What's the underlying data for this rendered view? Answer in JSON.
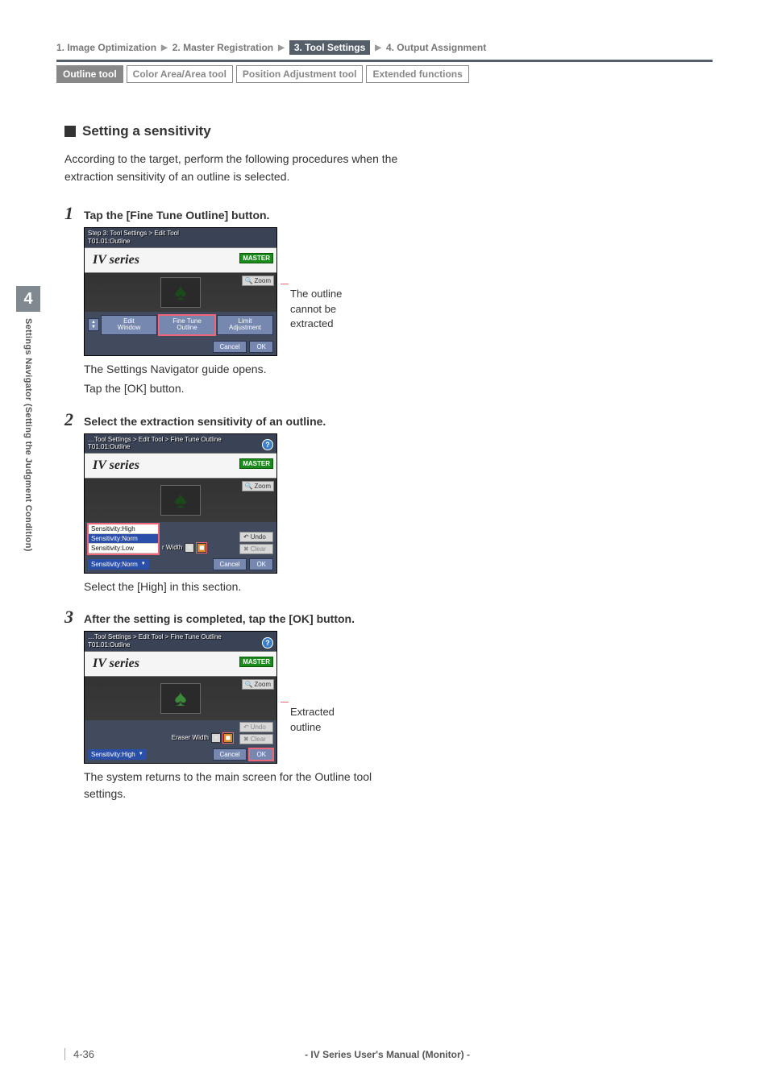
{
  "breadcrumb": {
    "items": [
      "1. Image Optimization",
      "2. Master Registration",
      "3. Tool Settings",
      "4. Output Assignment"
    ],
    "active_index": 2
  },
  "tabs": {
    "items": [
      "Outline tool",
      "Color Area/Area tool",
      "Position Adjustment tool",
      "Extended functions"
    ],
    "active_index": 0
  },
  "side_tab": {
    "chapter": "4",
    "title": "Settings Navigator (Setting the Judgment Condition)"
  },
  "section": {
    "title": "Setting a sensitivity"
  },
  "intro": "According to the target, perform the following procedures when the extraction sensitivity of an outline is selected.",
  "steps": {
    "s1": {
      "num": "1",
      "title": "Tap the [Fine Tune Outline] button.",
      "after1": "The Settings Navigator guide opens.",
      "after2": "Tap the [OK] button.",
      "callout": "The outline cannot be extracted"
    },
    "s2": {
      "num": "2",
      "title": "Select the extraction sensitivity of an outline.",
      "after": "Select the [High] in this section."
    },
    "s3": {
      "num": "3",
      "title": "After the setting is completed, tap the [OK] button.",
      "after": "The system returns to the main screen for the Outline tool settings.",
      "callout": "Extracted outline"
    }
  },
  "shot1": {
    "hdr1": "Step 3: Tool Settings > Edit Tool",
    "hdr2": "T01.01:Outline",
    "logo": "IV series",
    "master": "MASTER",
    "zoom": "Zoom",
    "btn_edit": "Edit\nWindow",
    "btn_fine": "Fine Tune\nOutline",
    "btn_limit": "Limit\nAdjustment",
    "cancel": "Cancel",
    "ok": "OK"
  },
  "shot2": {
    "hdr1": "…Tool Settings > Edit Tool > Fine Tune Outline",
    "hdr2": "T01.01:Outline",
    "logo": "IV series",
    "master": "MASTER",
    "zoom": "Zoom",
    "sens_high": "Sensitivity:High",
    "sens_norm": "Sensitivity:Norm",
    "sens_low": "Sensitivity:Low",
    "sens_cur": "Sensitivity:Norm",
    "eraser": "r Width",
    "undo": "Undo",
    "clear": "Clear",
    "cancel": "Cancel",
    "ok": "OK"
  },
  "shot3": {
    "hdr1": "…Tool Settings > Edit Tool > Fine Tune Outline",
    "hdr2": "T01.01:Outline",
    "logo": "IV series",
    "master": "MASTER",
    "zoom": "Zoom",
    "eraser": "Eraser Width",
    "sens_cur": "Sensitivity:High",
    "undo": "Undo",
    "clear": "Clear",
    "cancel": "Cancel",
    "ok": "OK"
  },
  "footer": {
    "page": "4-36",
    "title": "- IV Series User's Manual (Monitor) -"
  }
}
